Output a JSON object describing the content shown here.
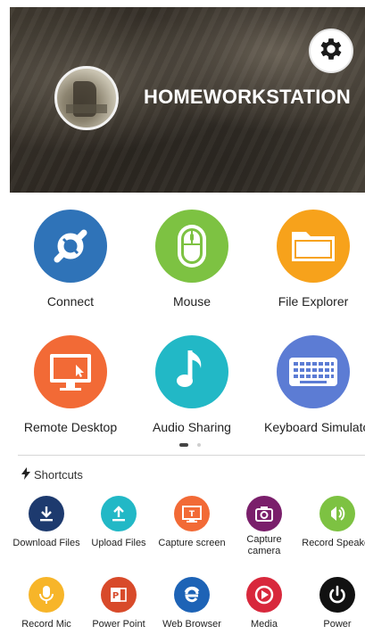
{
  "header": {
    "host_name": "HOMEWORKSTATION",
    "settings_icon": "gear-icon",
    "avatar_icon": "computer-avatar"
  },
  "apps": [
    {
      "label": "Connect",
      "icon": "connect-icon",
      "color": "#2f73b8"
    },
    {
      "label": "Mouse",
      "icon": "mouse-icon",
      "color": "#7dc242"
    },
    {
      "label": "File Explorer",
      "icon": "folder-icon",
      "color": "#f7a21b"
    },
    {
      "label": "Remote Desktop",
      "icon": "monitor-icon",
      "color": "#f26a36"
    },
    {
      "label": "Audio Sharing",
      "icon": "music-note-icon",
      "color": "#22b8c6"
    },
    {
      "label": "Keyboard Simulator",
      "icon": "keyboard-icon",
      "color": "#5c7cd4"
    }
  ],
  "pager": {
    "pages": 2,
    "active": 1
  },
  "shortcuts": {
    "title": "Shortcuts",
    "icon": "lightning-icon",
    "items": [
      {
        "label": "Download Files",
        "icon": "download-icon",
        "color": "#1d3a6e"
      },
      {
        "label": "Upload Files",
        "icon": "upload-icon",
        "color": "#22b8c6"
      },
      {
        "label": "Capture screen",
        "icon": "capture-screen-icon",
        "color": "#f26a36"
      },
      {
        "label": "Capture\ncamera",
        "icon": "camera-icon",
        "color": "#7a1f6b"
      },
      {
        "label": "Record Speaker",
        "icon": "speaker-icon",
        "color": "#7dc242"
      },
      {
        "label": "Record Mic",
        "icon": "microphone-icon",
        "color": "#f7b529"
      },
      {
        "label": "Power Point",
        "icon": "powerpoint-icon",
        "color": "#d84a2a"
      },
      {
        "label": "Web Browser",
        "icon": "web-browser-icon",
        "color": "#1d63b6"
      },
      {
        "label": "Media",
        "icon": "media-play-icon",
        "color": "#d8283c"
      },
      {
        "label": "Power",
        "icon": "power-icon",
        "color": "#111111"
      }
    ]
  }
}
